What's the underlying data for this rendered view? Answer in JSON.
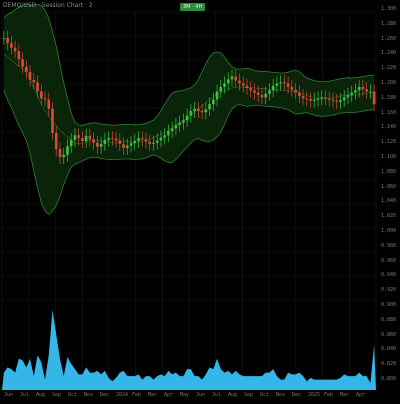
{
  "header": {
    "title": "DEMO/USD · Session Chart · 2",
    "badge": "3M  ·  4H"
  },
  "price_axis": {
    "labels": [
      "1.300",
      "1.280",
      "1.260",
      "1.240",
      "1.220",
      "1.200",
      "1.180",
      "1.160",
      "1.140",
      "1.120",
      "1.100",
      "1.080",
      "1.060",
      "1.040",
      "1.020",
      "1.000",
      "0.980",
      "0.960",
      "0.940",
      "0.920",
      "0.900",
      "0.880",
      "0.860",
      "0.840",
      "0.820",
      "0.800"
    ]
  },
  "time_axis": {
    "labels": [
      "Jun",
      "Jul",
      "Aug",
      "Sep",
      "Oct",
      "Nov",
      "Dec",
      "2024",
      "Feb",
      "Mar",
      "Apr",
      "May",
      "Jun",
      "Jul",
      "Aug",
      "Sep",
      "Oct",
      "Nov",
      "Dec",
      "2025",
      "Feb",
      "Mar",
      "Apr"
    ]
  },
  "colors": {
    "background": "#000000",
    "bull": "#3fbf3f",
    "bear": "#e0473b",
    "band_fill": "#0c2a0c",
    "band_line": "#2f7f2f",
    "volume": "#35b6e8",
    "grid": "#1c1c1c"
  },
  "chart_data": {
    "type": "line",
    "title": "",
    "xlabel": "",
    "ylabel": "",
    "series": [
      {
        "name": "",
        "y": [
          1.255,
          1.246,
          1.238,
          1.232,
          1.218,
          1.205,
          1.196,
          1.182,
          1.178,
          1.162,
          1.15,
          1.148,
          1.132,
          1.09,
          1.062,
          1.048,
          1.052,
          1.067,
          1.078,
          1.086,
          1.081,
          1.076,
          1.085,
          1.079,
          1.073,
          1.066,
          1.071,
          1.078,
          1.081,
          1.08,
          1.077,
          1.071,
          1.064,
          1.068,
          1.072,
          1.076,
          1.081,
          1.079,
          1.075,
          1.071,
          1.073,
          1.077,
          1.082,
          1.086,
          1.093,
          1.098,
          1.104,
          1.108,
          1.112,
          1.12,
          1.128,
          1.132,
          1.128,
          1.126,
          1.131,
          1.14,
          1.148,
          1.162,
          1.17,
          1.176,
          1.183,
          1.188,
          1.181,
          1.176,
          1.172,
          1.168,
          1.164,
          1.16,
          1.156,
          1.152,
          1.158,
          1.164,
          1.172,
          1.176,
          1.178,
          1.176,
          1.17,
          1.165,
          1.16,
          1.154,
          1.15,
          1.149,
          1.146,
          1.148,
          1.15,
          1.152,
          1.15,
          1.148,
          1.146,
          1.144,
          1.147,
          1.152,
          1.156,
          1.16,
          1.164,
          1.17,
          1.166,
          1.162,
          1.162,
          1.14
        ]
      }
    ],
    "ylim": [
      0.8,
      1.3
    ],
    "grid": true,
    "legend": "none"
  }
}
